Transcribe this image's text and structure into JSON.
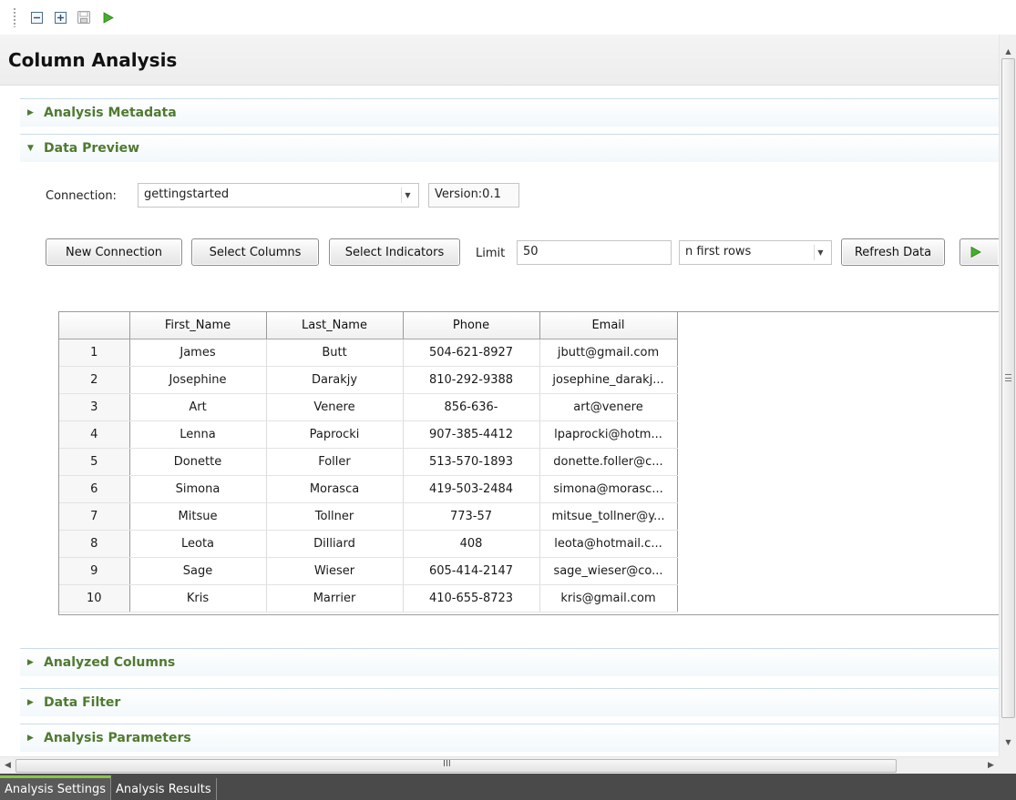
{
  "toolbar": {
    "buttons": [
      {
        "name": "collapse-all-icon"
      },
      {
        "name": "expand-all-icon"
      },
      {
        "name": "save-icon"
      },
      {
        "name": "run-icon"
      }
    ]
  },
  "header": {
    "title": "Column Analysis"
  },
  "sections": {
    "analysis_metadata": "Analysis Metadata",
    "data_preview": "Data Preview",
    "analyzed_columns": "Analyzed Columns",
    "data_filter": "Data Filter",
    "analysis_parameters": "Analysis Parameters"
  },
  "preview": {
    "connection_label": "Connection:",
    "connection_value": "gettingstarted",
    "version": "Version:0.1",
    "new_connection": "New Connection",
    "select_columns": "Select Columns",
    "select_indicators": "Select Indicators",
    "limit_label": "Limit",
    "limit_value": "50",
    "row_mode": "n first rows",
    "refresh": "Refresh Data"
  },
  "table": {
    "columns": [
      "",
      "First_Name",
      "Last_Name",
      "Phone",
      "Email"
    ],
    "rows": [
      [
        "1",
        "James",
        "Butt",
        "504-621-8927",
        "jbutt@gmail.com"
      ],
      [
        "2",
        "Josephine",
        "Darakjy",
        "810-292-9388",
        "josephine_darakj..."
      ],
      [
        "3",
        "Art",
        "Venere",
        "856-636-",
        "art@venere"
      ],
      [
        "4",
        "Lenna",
        "Paprocki",
        "907-385-4412",
        "lpaprocki@hotm..."
      ],
      [
        "5",
        "Donette",
        "Foller",
        "513-570-1893",
        "donette.foller@c..."
      ],
      [
        "6",
        "Simona",
        "Morasca",
        "419-503-2484",
        "simona@morasc..."
      ],
      [
        "7",
        "Mitsue",
        "Tollner",
        "773-57",
        "mitsue_tollner@y..."
      ],
      [
        "8",
        "Leota",
        "Dilliard",
        "408",
        "leota@hotmail.c..."
      ],
      [
        "9",
        "Sage",
        "Wieser",
        "605-414-2147",
        "sage_wieser@co..."
      ],
      [
        "10",
        "Kris",
        "Marrier",
        "410-655-8723",
        "kris@gmail.com"
      ]
    ]
  },
  "scrollbars": {
    "h_grip": "III"
  },
  "bottom_tabs": [
    "Analysis Settings",
    "Analysis Results"
  ],
  "colors": {
    "section_title": "#4f7a30",
    "run_green": "#3a9d23",
    "tab_active_border": "#8fc34a"
  }
}
